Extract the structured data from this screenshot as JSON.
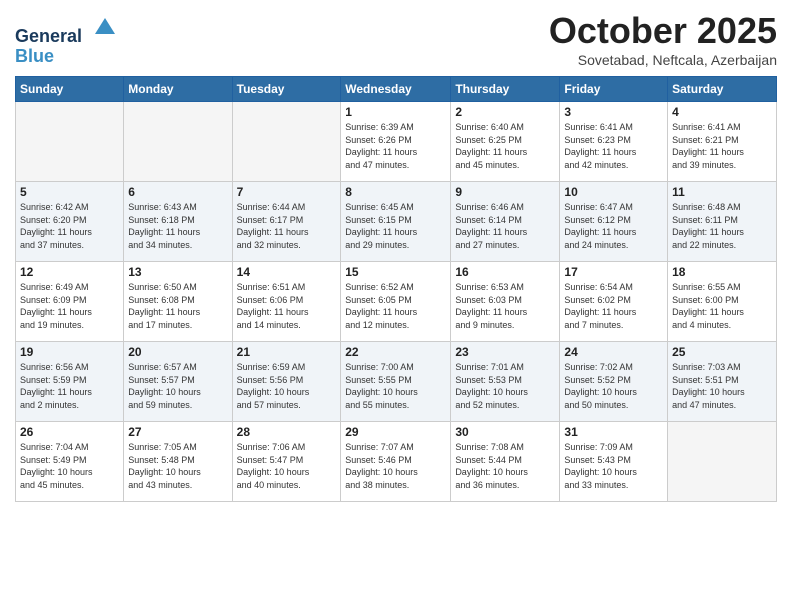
{
  "header": {
    "logo_line1": "General",
    "logo_line2": "Blue",
    "month": "October 2025",
    "location": "Sovetabad, Neftcala, Azerbaijan"
  },
  "weekdays": [
    "Sunday",
    "Monday",
    "Tuesday",
    "Wednesday",
    "Thursday",
    "Friday",
    "Saturday"
  ],
  "weeks": [
    [
      {
        "num": "",
        "info": ""
      },
      {
        "num": "",
        "info": ""
      },
      {
        "num": "",
        "info": ""
      },
      {
        "num": "1",
        "info": "Sunrise: 6:39 AM\nSunset: 6:26 PM\nDaylight: 11 hours\nand 47 minutes."
      },
      {
        "num": "2",
        "info": "Sunrise: 6:40 AM\nSunset: 6:25 PM\nDaylight: 11 hours\nand 45 minutes."
      },
      {
        "num": "3",
        "info": "Sunrise: 6:41 AM\nSunset: 6:23 PM\nDaylight: 11 hours\nand 42 minutes."
      },
      {
        "num": "4",
        "info": "Sunrise: 6:41 AM\nSunset: 6:21 PM\nDaylight: 11 hours\nand 39 minutes."
      }
    ],
    [
      {
        "num": "5",
        "info": "Sunrise: 6:42 AM\nSunset: 6:20 PM\nDaylight: 11 hours\nand 37 minutes."
      },
      {
        "num": "6",
        "info": "Sunrise: 6:43 AM\nSunset: 6:18 PM\nDaylight: 11 hours\nand 34 minutes."
      },
      {
        "num": "7",
        "info": "Sunrise: 6:44 AM\nSunset: 6:17 PM\nDaylight: 11 hours\nand 32 minutes."
      },
      {
        "num": "8",
        "info": "Sunrise: 6:45 AM\nSunset: 6:15 PM\nDaylight: 11 hours\nand 29 minutes."
      },
      {
        "num": "9",
        "info": "Sunrise: 6:46 AM\nSunset: 6:14 PM\nDaylight: 11 hours\nand 27 minutes."
      },
      {
        "num": "10",
        "info": "Sunrise: 6:47 AM\nSunset: 6:12 PM\nDaylight: 11 hours\nand 24 minutes."
      },
      {
        "num": "11",
        "info": "Sunrise: 6:48 AM\nSunset: 6:11 PM\nDaylight: 11 hours\nand 22 minutes."
      }
    ],
    [
      {
        "num": "12",
        "info": "Sunrise: 6:49 AM\nSunset: 6:09 PM\nDaylight: 11 hours\nand 19 minutes."
      },
      {
        "num": "13",
        "info": "Sunrise: 6:50 AM\nSunset: 6:08 PM\nDaylight: 11 hours\nand 17 minutes."
      },
      {
        "num": "14",
        "info": "Sunrise: 6:51 AM\nSunset: 6:06 PM\nDaylight: 11 hours\nand 14 minutes."
      },
      {
        "num": "15",
        "info": "Sunrise: 6:52 AM\nSunset: 6:05 PM\nDaylight: 11 hours\nand 12 minutes."
      },
      {
        "num": "16",
        "info": "Sunrise: 6:53 AM\nSunset: 6:03 PM\nDaylight: 11 hours\nand 9 minutes."
      },
      {
        "num": "17",
        "info": "Sunrise: 6:54 AM\nSunset: 6:02 PM\nDaylight: 11 hours\nand 7 minutes."
      },
      {
        "num": "18",
        "info": "Sunrise: 6:55 AM\nSunset: 6:00 PM\nDaylight: 11 hours\nand 4 minutes."
      }
    ],
    [
      {
        "num": "19",
        "info": "Sunrise: 6:56 AM\nSunset: 5:59 PM\nDaylight: 11 hours\nand 2 minutes."
      },
      {
        "num": "20",
        "info": "Sunrise: 6:57 AM\nSunset: 5:57 PM\nDaylight: 10 hours\nand 59 minutes."
      },
      {
        "num": "21",
        "info": "Sunrise: 6:59 AM\nSunset: 5:56 PM\nDaylight: 10 hours\nand 57 minutes."
      },
      {
        "num": "22",
        "info": "Sunrise: 7:00 AM\nSunset: 5:55 PM\nDaylight: 10 hours\nand 55 minutes."
      },
      {
        "num": "23",
        "info": "Sunrise: 7:01 AM\nSunset: 5:53 PM\nDaylight: 10 hours\nand 52 minutes."
      },
      {
        "num": "24",
        "info": "Sunrise: 7:02 AM\nSunset: 5:52 PM\nDaylight: 10 hours\nand 50 minutes."
      },
      {
        "num": "25",
        "info": "Sunrise: 7:03 AM\nSunset: 5:51 PM\nDaylight: 10 hours\nand 47 minutes."
      }
    ],
    [
      {
        "num": "26",
        "info": "Sunrise: 7:04 AM\nSunset: 5:49 PM\nDaylight: 10 hours\nand 45 minutes."
      },
      {
        "num": "27",
        "info": "Sunrise: 7:05 AM\nSunset: 5:48 PM\nDaylight: 10 hours\nand 43 minutes."
      },
      {
        "num": "28",
        "info": "Sunrise: 7:06 AM\nSunset: 5:47 PM\nDaylight: 10 hours\nand 40 minutes."
      },
      {
        "num": "29",
        "info": "Sunrise: 7:07 AM\nSunset: 5:46 PM\nDaylight: 10 hours\nand 38 minutes."
      },
      {
        "num": "30",
        "info": "Sunrise: 7:08 AM\nSunset: 5:44 PM\nDaylight: 10 hours\nand 36 minutes."
      },
      {
        "num": "31",
        "info": "Sunrise: 7:09 AM\nSunset: 5:43 PM\nDaylight: 10 hours\nand 33 minutes."
      },
      {
        "num": "",
        "info": ""
      }
    ]
  ]
}
